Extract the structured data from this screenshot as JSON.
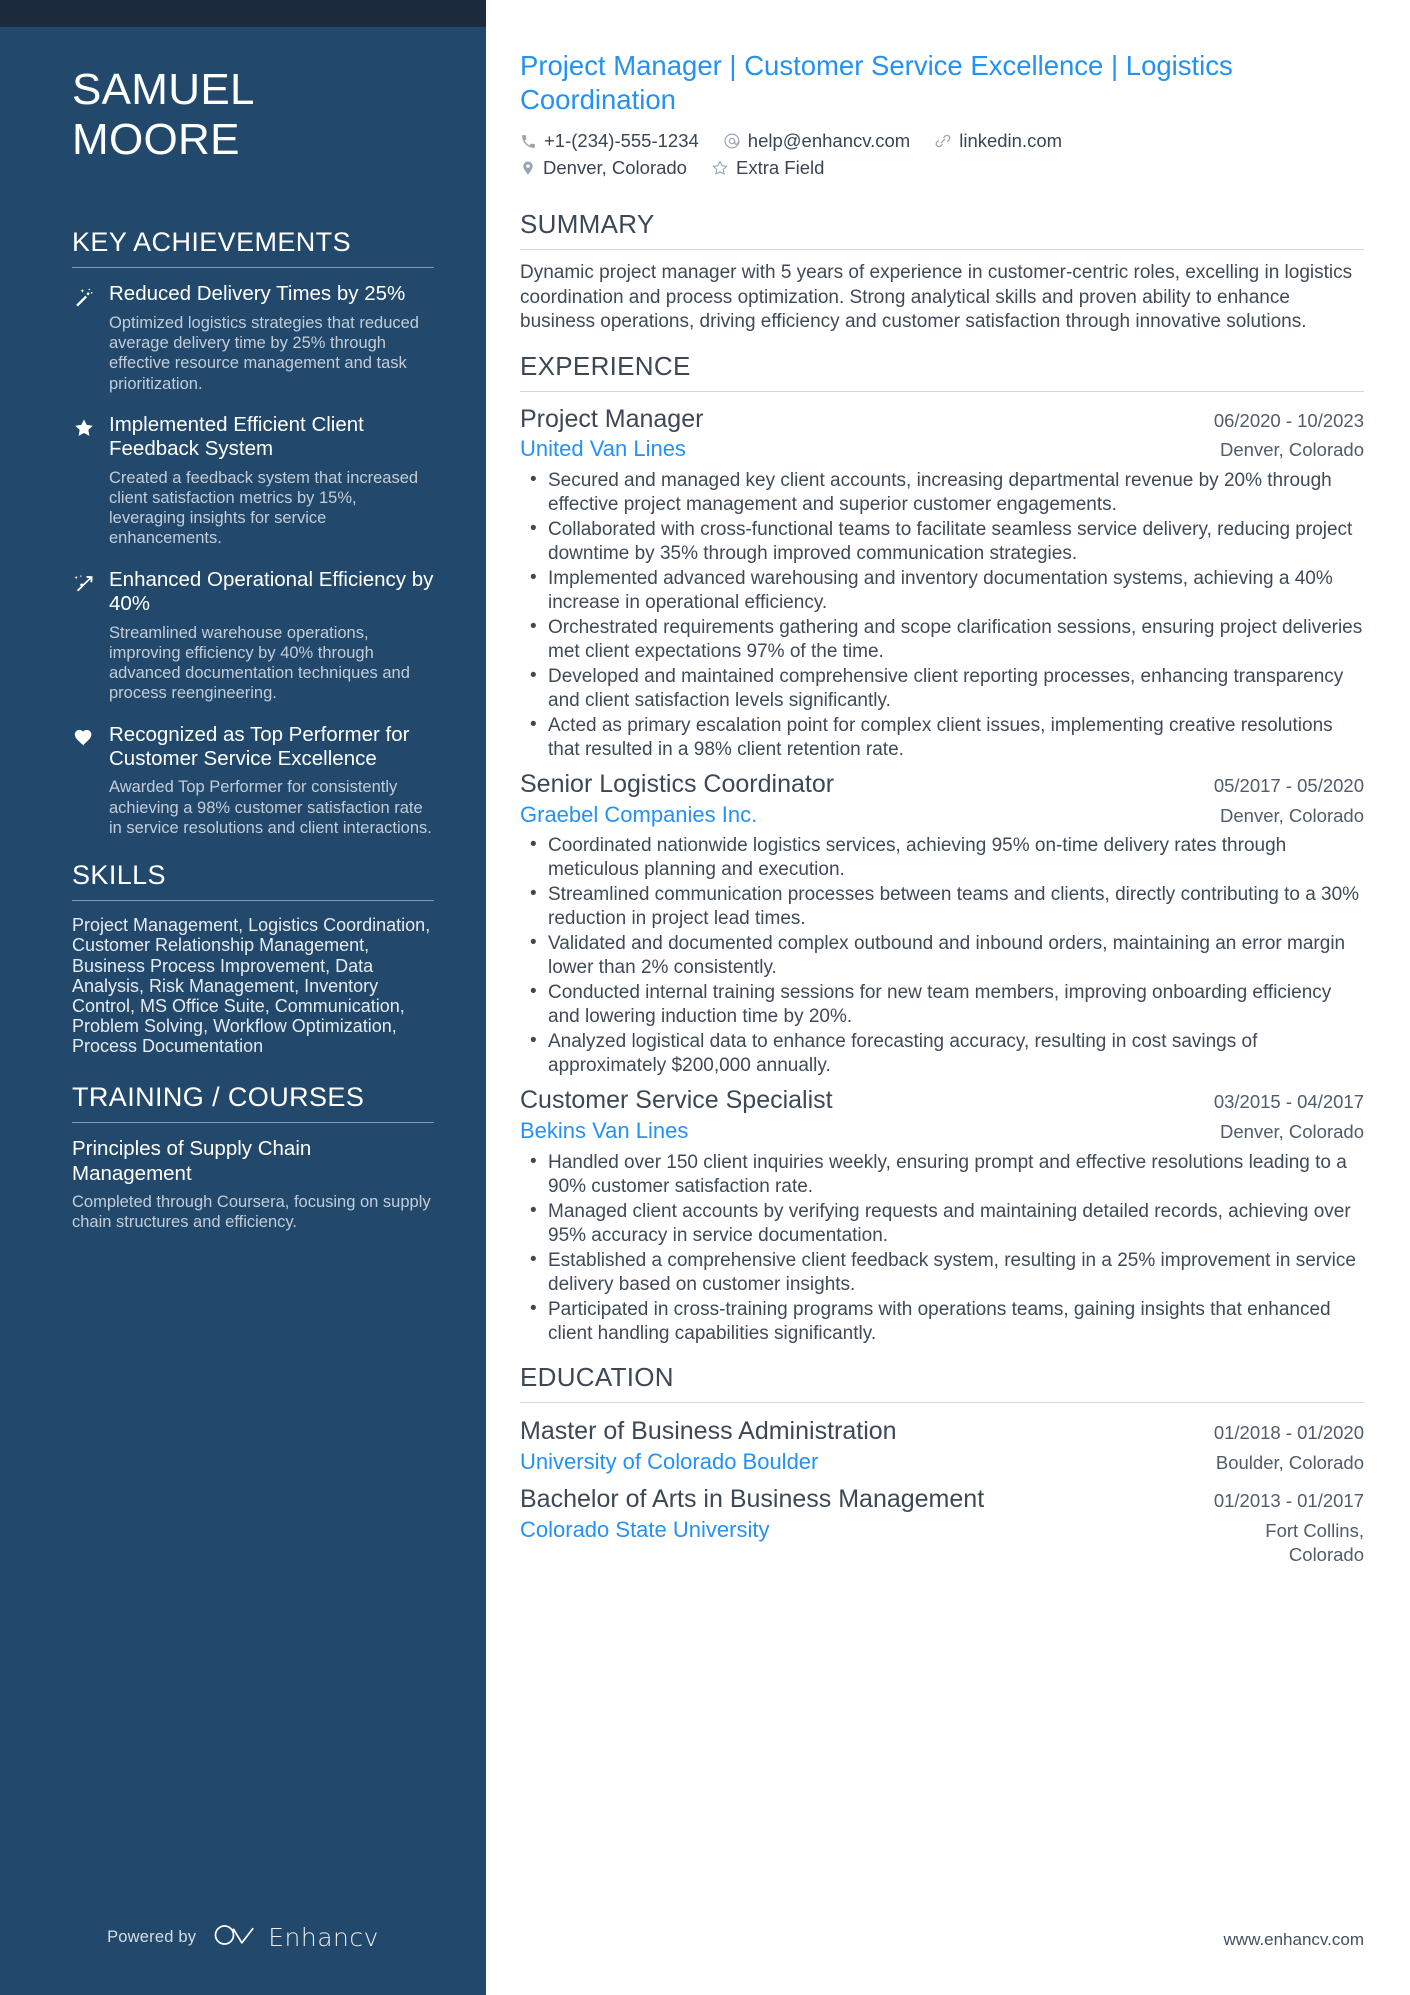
{
  "sidebar": {
    "name_first": "SAMUEL",
    "name_last": "MOORE",
    "achievements_heading": "KEY ACHIEVEMENTS",
    "achievements": [
      {
        "icon": "magic-wand-icon",
        "title": "Reduced Delivery Times by 25%",
        "description": "Optimized logistics strategies that reduced average delivery time by 25% through effective resource management and task prioritization."
      },
      {
        "icon": "star-icon",
        "title": "Implemented Efficient Client Feedback System",
        "description": "Created a feedback system that increased client satisfaction metrics by 15%, leveraging insights for service enhancements."
      },
      {
        "icon": "trending-arrow-icon",
        "title": "Enhanced Operational Efficiency by 40%",
        "description": "Streamlined warehouse operations, improving efficiency by 40% through advanced documentation techniques and process reengineering."
      },
      {
        "icon": "heart-icon",
        "title": "Recognized as Top Performer for Customer Service Excellence",
        "description": "Awarded Top Performer for consistently achieving a 98% customer satisfaction rate in service resolutions and client interactions."
      }
    ],
    "skills_heading": "SKILLS",
    "skills_text": "Project Management, Logistics Coordination, Customer Relationship Management, Business Process Improvement, Data Analysis, Risk Management, Inventory Control, MS Office Suite, Communication, Problem Solving, Workflow Optimization, Process Documentation",
    "training_heading": "TRAINING / COURSES",
    "courses": [
      {
        "title": "Principles of Supply Chain Management",
        "description": "Completed through Coursera, focusing on supply chain structures and efficiency."
      }
    ],
    "powered_by_label": "Powered by",
    "brand_name": "Enhancv"
  },
  "header": {
    "headline": "Project Manager | Customer Service Excellence | Logistics Coordination",
    "contacts_row1": [
      {
        "icon": "phone-icon",
        "value": "+1-(234)-555-1234"
      },
      {
        "icon": "email-icon",
        "value": "help@enhancv.com"
      },
      {
        "icon": "link-icon",
        "value": "linkedin.com"
      }
    ],
    "contacts_row2": [
      {
        "icon": "location-pin-icon",
        "value": "Denver, Colorado"
      },
      {
        "icon": "star-outline-icon",
        "value": "Extra Field"
      }
    ]
  },
  "summary": {
    "heading": "SUMMARY",
    "text": "Dynamic project manager with 5 years of experience in customer-centric roles, excelling in logistics coordination and process optimization. Strong analytical skills and proven ability to enhance business operations, driving efficiency and customer satisfaction through innovative solutions."
  },
  "experience": {
    "heading": "EXPERIENCE",
    "jobs": [
      {
        "title": "Project Manager",
        "date": "06/2020 - 10/2023",
        "company": "United Van Lines",
        "location": "Denver, Colorado",
        "bullets": [
          "Secured and managed key client accounts, increasing departmental revenue by 20% through effective project management and superior customer engagements.",
          "Collaborated with cross-functional teams to facilitate seamless service delivery, reducing project downtime by 35% through improved communication strategies.",
          "Implemented advanced warehousing and inventory documentation systems, achieving a 40% increase in operational efficiency.",
          "Orchestrated requirements gathering and scope clarification sessions, ensuring project deliveries met client expectations 97% of the time.",
          "Developed and maintained comprehensive client reporting processes, enhancing transparency and client satisfaction levels significantly.",
          "Acted as primary escalation point for complex client issues, implementing creative resolutions that resulted in a 98% client retention rate."
        ]
      },
      {
        "title": "Senior Logistics Coordinator",
        "date": "05/2017 - 05/2020",
        "company": "Graebel Companies Inc.",
        "location": "Denver, Colorado",
        "bullets": [
          "Coordinated nationwide logistics services, achieving 95% on-time delivery rates through meticulous planning and execution.",
          "Streamlined communication processes between teams and clients, directly contributing to a 30% reduction in project lead times.",
          "Validated and documented complex outbound and inbound orders, maintaining an error margin lower than 2% consistently.",
          "Conducted internal training sessions for new team members, improving onboarding efficiency and lowering induction time by 20%.",
          "Analyzed logistical data to enhance forecasting accuracy, resulting in cost savings of approximately $200,000 annually."
        ]
      },
      {
        "title": "Customer Service Specialist",
        "date": "03/2015 - 04/2017",
        "company": "Bekins Van Lines",
        "location": "Denver, Colorado",
        "bullets": [
          "Handled over 150 client inquiries weekly, ensuring prompt and effective resolutions leading to a 90% customer satisfaction rate.",
          "Managed client accounts by verifying requests and maintaining detailed records, achieving over 95% accuracy in service documentation.",
          "Established a comprehensive client feedback system, resulting in a 25% improvement in service delivery based on customer insights.",
          "Participated in cross-training programs with operations teams, gaining insights that enhanced client handling capabilities significantly."
        ]
      }
    ]
  },
  "education": {
    "heading": "EDUCATION",
    "entries": [
      {
        "degree": "Master of Business Administration",
        "date": "01/2018 - 01/2020",
        "school": "University of Colorado Boulder",
        "location": "Boulder, Colorado"
      },
      {
        "degree": "Bachelor of Arts in Business Management",
        "date": "01/2013 - 01/2017",
        "school": "Colorado State University",
        "location": "Fort Collins, Colorado"
      }
    ]
  },
  "footer": {
    "site_url": "www.enhancv.com"
  },
  "colors": {
    "sidebar_bg": "#22486b",
    "sidebar_topbar": "#1b2b3d",
    "accent_blue": "#2491f5",
    "body_text": "#3f4a57"
  }
}
